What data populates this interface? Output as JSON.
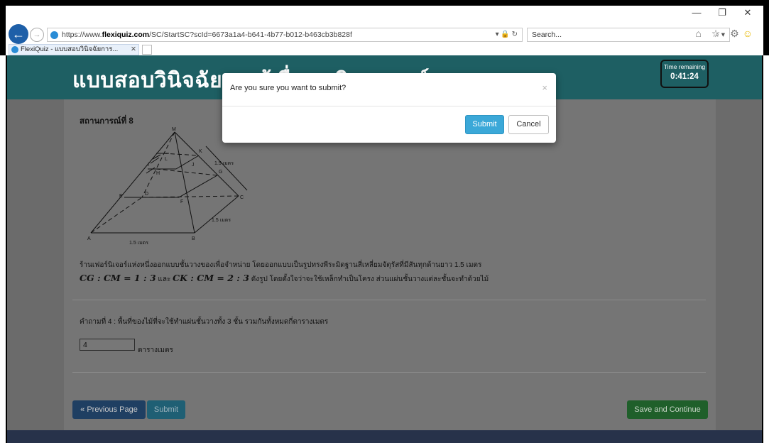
{
  "window": {
    "minimize": "—",
    "restore": "❐",
    "close": "✕"
  },
  "browser": {
    "back_icon": "back-arrow-icon",
    "forward_icon": "forward-arrow-icon",
    "url_prefix": "https://www.",
    "url_domain": "flexiquiz.com",
    "url_rest": "/SC/StartSC?scId=6673a1a4-b641-4b77-b012-b463cb3b828f",
    "url_icons": "▾ 🔒 ↻",
    "search_placeholder": "Search...",
    "search_icon": "⌕ ▾",
    "toolbar_icons": "⌂ ☆ ⚙",
    "smile": "☺",
    "tab_title": "FlexiQuiz - แบบสอบวินิจฉัยการ...",
    "tab_close": "✕"
  },
  "header": {
    "title": "แบบสอบวินิจฉัยการรู้เรื่องคณิตศาสตร์",
    "timer_label": "Time remaining",
    "timer_value": "0:41:24"
  },
  "question": {
    "scenario_title": "สถานการณ์ที่ 8",
    "description_line1": "ร้านเฟอร์นิเจอร์แห่งหนึ่งออกแบบชั้นวางของเพื่อจำหน่าย โดยออกแบบเป็นรูปทรงพีระมิดฐานสี่เหลี่ยมจัตุรัสที่มีสันทุกด้านยาว 1.5 เมตร",
    "math_ratio1": "CG : CM = 1 : 3",
    "conj": " และ ",
    "math_ratio2": "CK : CM = 2 : 3",
    "description_line2_rest": " ดังรูป โดยตั้งใจว่าจะใช้เหล็กทำเป็นโครง ส่วนแผ่นชั้นวางแต่ละชั้นจะทำด้วยไม้",
    "prompt": "คำถามที่ 4 : พื้นที่ของไม้ที่จะใช้ทำแผ่นชั้นวางทั้ง 3 ชั้น รวมกันทั้งหมดกี่ตารางเมตร",
    "answer_value": "4",
    "unit": "ตารางเมตร",
    "figure_labels": {
      "M": "M",
      "K": "K",
      "L": "L",
      "J": "J",
      "I": "I",
      "G": "G",
      "H": "H",
      "E": "E",
      "D": "D",
      "C": "C",
      "F": "F",
      "A": "A",
      "B": "B",
      "edge_label_top": "1.5 เมตร",
      "edge_label_right": "1.5 เมตร",
      "edge_label_bottom": "1.5 เมตร"
    }
  },
  "buttons": {
    "previous": "« Previous Page",
    "submit": "Submit",
    "save_continue": "Save and Continue"
  },
  "modal": {
    "title": "Are you sure you want to submit?",
    "close": "×",
    "submit": "Submit",
    "cancel": "Cancel"
  }
}
